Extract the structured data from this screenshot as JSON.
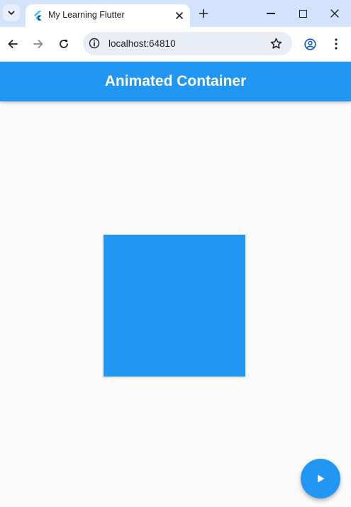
{
  "browser": {
    "tab_title": "My Learning Flutter",
    "url": "localhost:64810"
  },
  "app": {
    "title": "Animated Container",
    "box_color": "#2196f3",
    "appbar_color": "#2196f3",
    "fab_icon": "play-arrow-icon"
  }
}
